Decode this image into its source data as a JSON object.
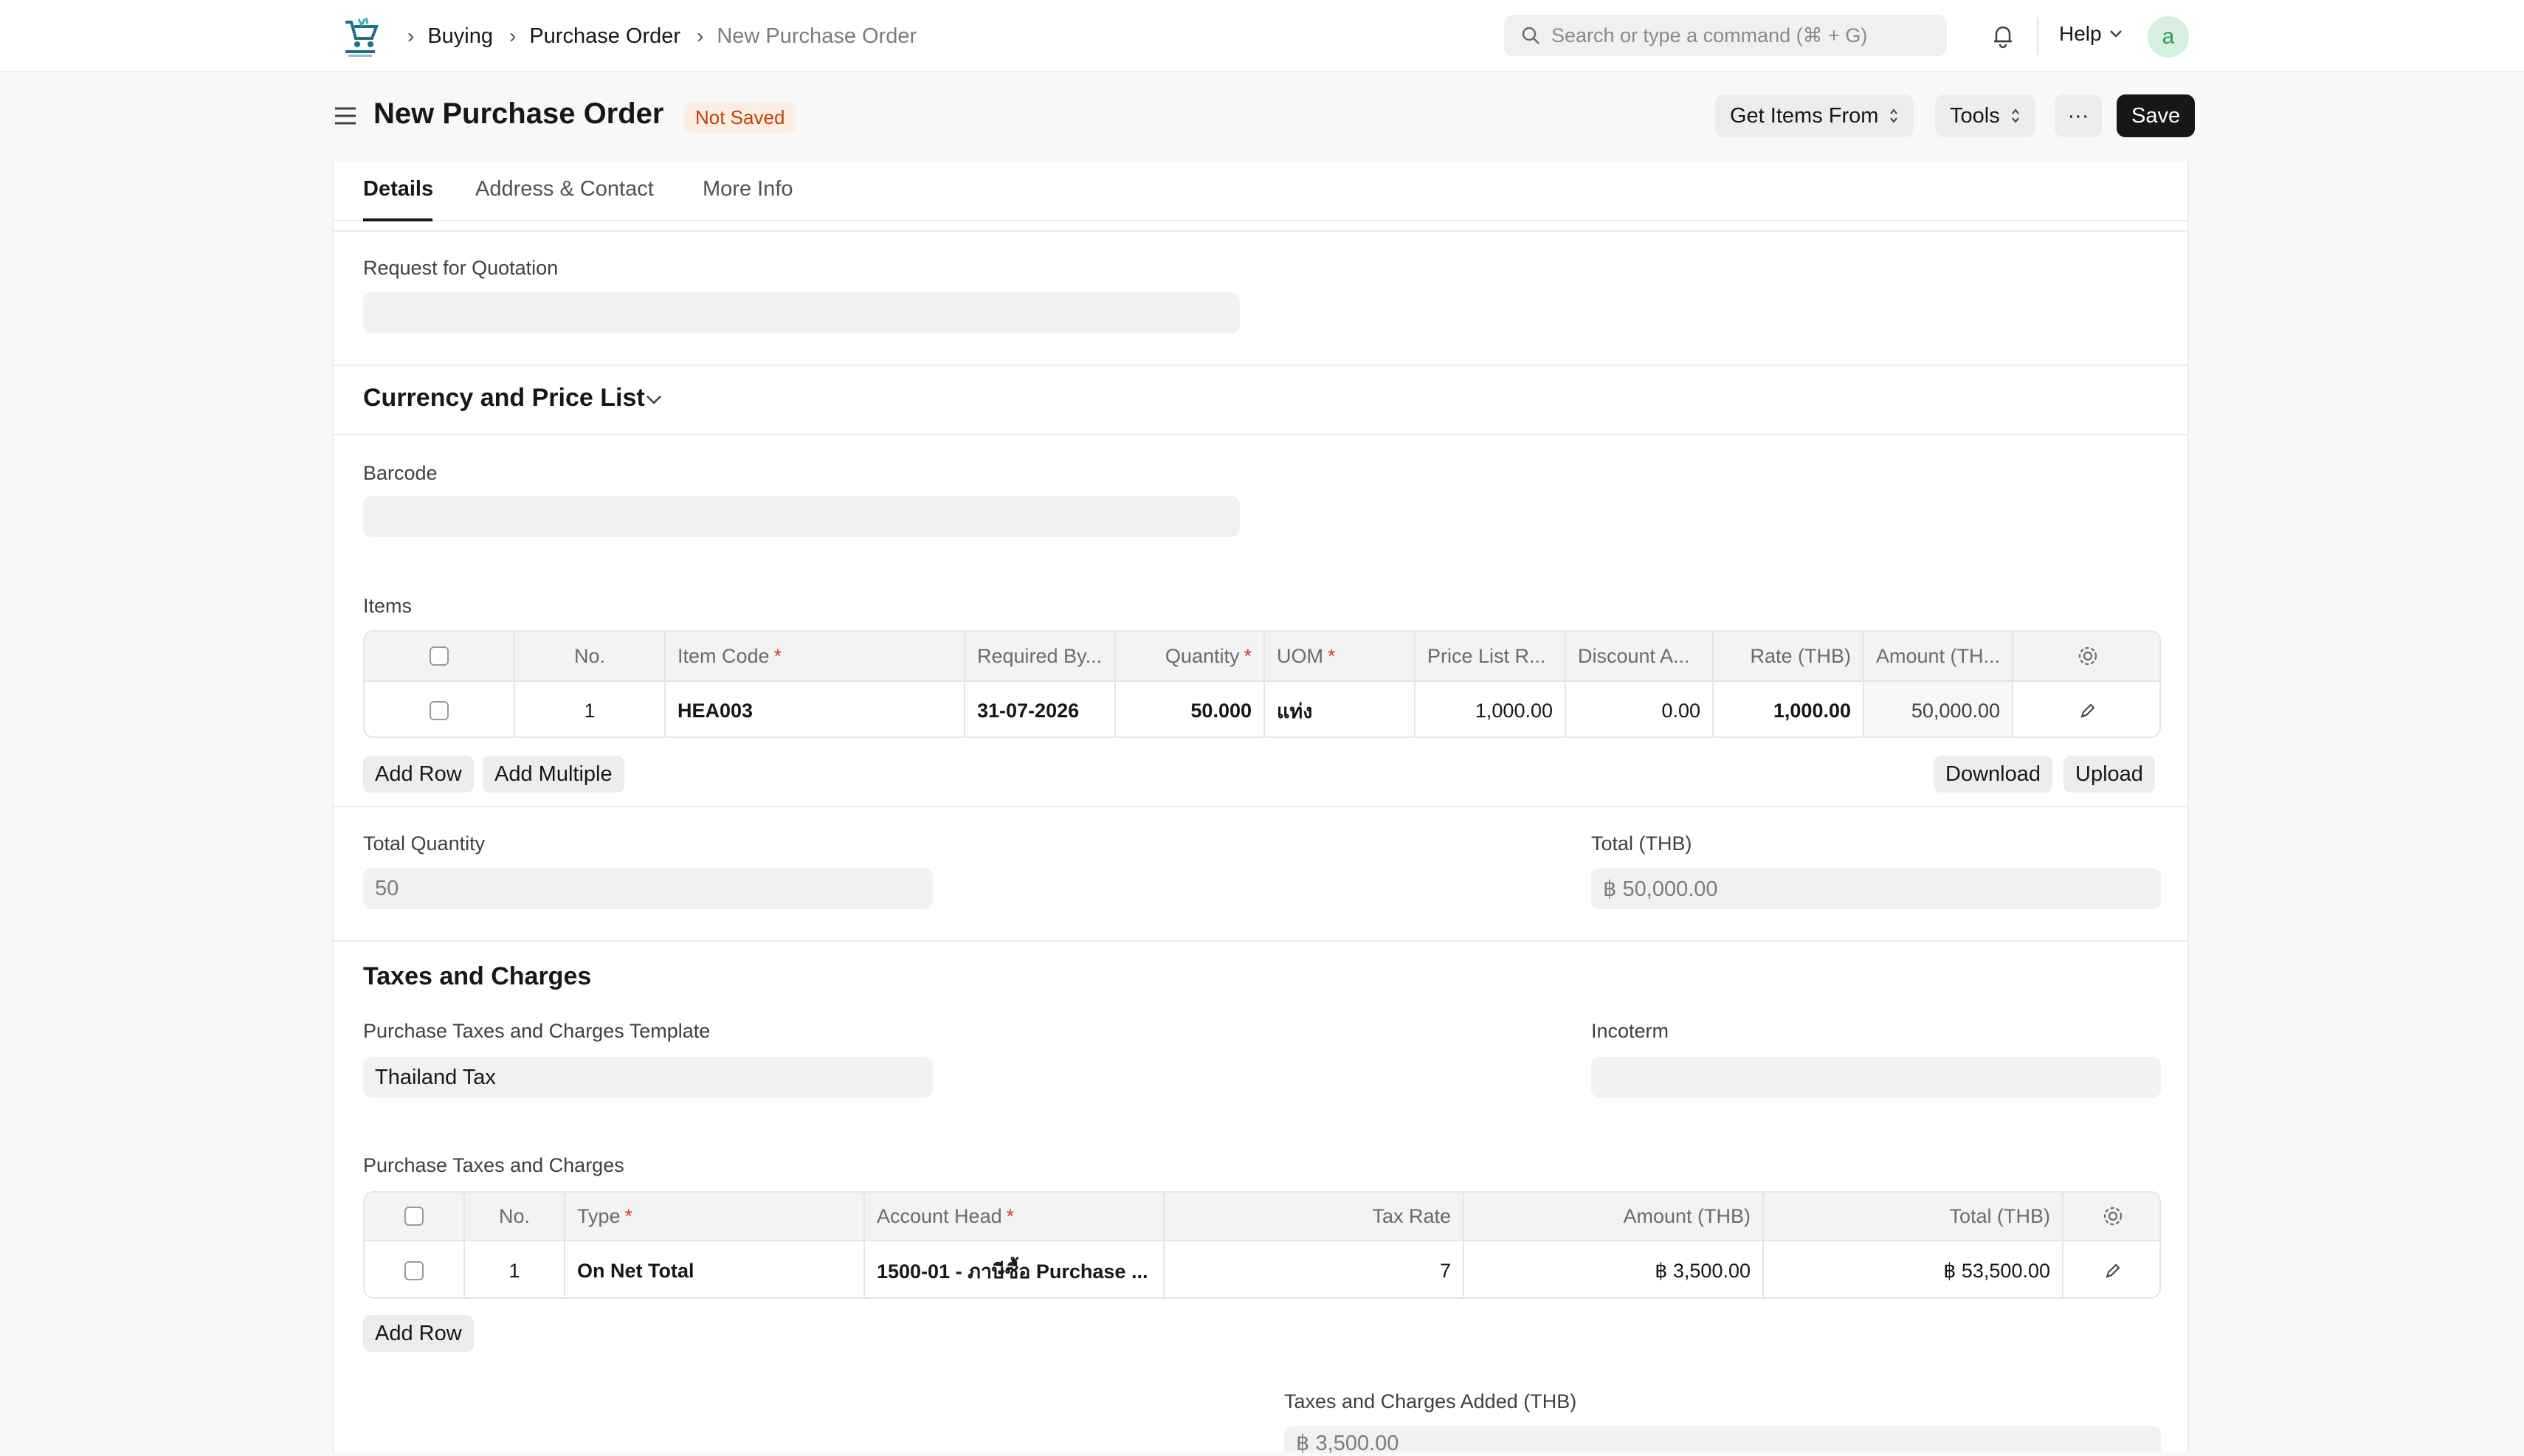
{
  "navbar": {
    "breadcrumbs": [
      "Buying",
      "Purchase Order",
      "New Purchase Order"
    ],
    "search_placeholder": "Search or type a command (⌘ + G)",
    "help_label": "Help",
    "avatar_initial": "a"
  },
  "page": {
    "title": "New Purchase Order",
    "status_badge": "Not Saved",
    "get_items_label": "Get Items From",
    "tools_label": "Tools",
    "more_label": "···",
    "save_label": "Save"
  },
  "tabs": [
    {
      "label": "Details",
      "active": true
    },
    {
      "label": "Address & Contact",
      "active": false
    },
    {
      "label": "More Info",
      "active": false
    }
  ],
  "form": {
    "rfq_label": "Request for Quotation",
    "rfq_value": "",
    "currency_section": "Currency and Price List",
    "barcode_label": "Barcode",
    "barcode_value": "",
    "items_label": "Items",
    "total_qty_label": "Total Quantity",
    "total_qty_value": "50",
    "total_label": "Total (THB)",
    "total_value": "฿ 50,000.00",
    "taxes_section": "Taxes and Charges",
    "tax_template_label": "Purchase Taxes and Charges Template",
    "tax_template_value": "Thailand Tax",
    "incoterm_label": "Incoterm",
    "incoterm_value": "",
    "taxes_table_label": "Purchase Taxes and Charges",
    "taxes_added_label": "Taxes and Charges Added (THB)",
    "taxes_added_value": "฿ 3,500.00"
  },
  "items_table": {
    "headers": {
      "no": "No.",
      "item_code": "Item Code",
      "required_by": "Required By...",
      "quantity": "Quantity",
      "uom": "UOM",
      "price_list_rate": "Price List R...",
      "discount": "Discount A...",
      "rate": "Rate (THB)",
      "amount": "Amount (TH..."
    },
    "rows": [
      {
        "no": "1",
        "item_code": "HEA003",
        "required_by": "31-07-2026",
        "quantity": "50.000",
        "uom": "แท่ง",
        "price_list_rate": "1,000.00",
        "discount": "0.00",
        "rate": "1,000.00",
        "amount": "50,000.00"
      }
    ],
    "add_row_label": "Add Row",
    "add_multiple_label": "Add Multiple",
    "download_label": "Download",
    "upload_label": "Upload"
  },
  "taxes_table": {
    "headers": {
      "no": "No.",
      "type": "Type",
      "account_head": "Account Head",
      "tax_rate": "Tax Rate",
      "amount": "Amount (THB)",
      "total": "Total (THB)"
    },
    "rows": [
      {
        "no": "1",
        "type": "On Net Total",
        "account_head": "1500-01 - ภาษีซื้อ Purchase ...",
        "tax_rate": "7",
        "amount": "฿ 3,500.00",
        "total": "฿ 53,500.00"
      }
    ],
    "add_row_label": "Add Row"
  },
  "colors": {
    "accent_dark": "#171717",
    "badge_bg": "#fdeee4",
    "badge_text": "#c2410c",
    "required": "#e03131",
    "avatar_bg": "#d5f0df",
    "avatar_text": "#2f9e5b"
  },
  "icons": [
    "app-logo-icon",
    "chevron-right-icon",
    "search-icon",
    "bell-icon",
    "chevron-down-icon",
    "hamburger-menu-icon",
    "sort-arrows-icon",
    "gear-icon",
    "pencil-edit-icon"
  ]
}
